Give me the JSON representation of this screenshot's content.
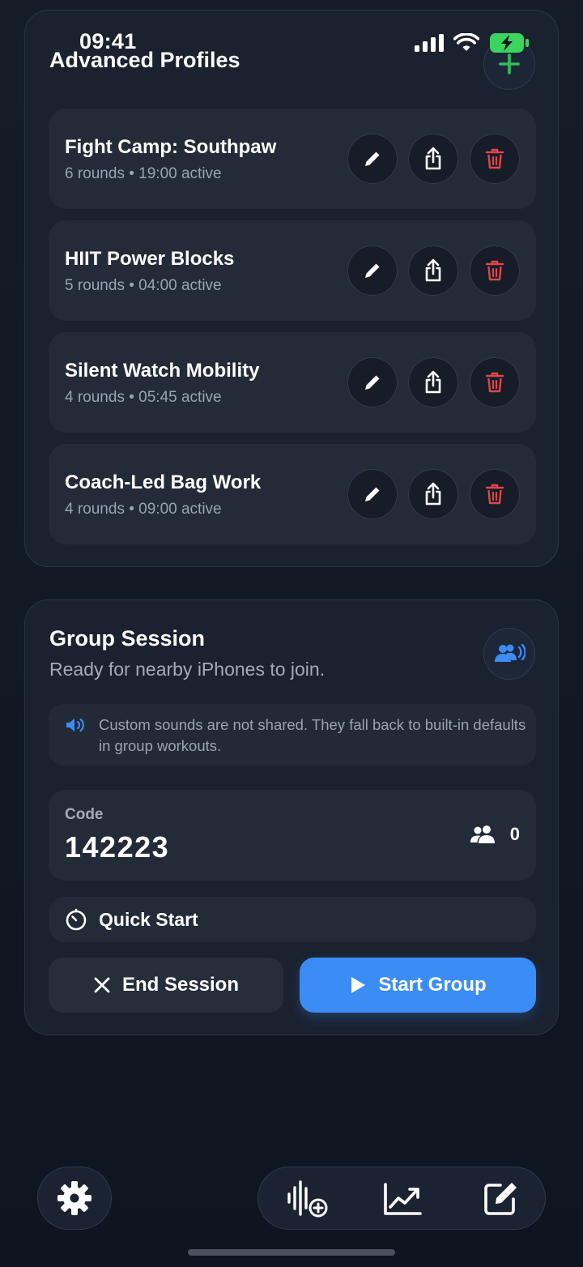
{
  "status_bar": {
    "time": "09:41"
  },
  "profiles_card": {
    "title": "Advanced Profiles",
    "profiles": [
      {
        "name": "Fight Camp: Southpaw",
        "meta": "6 rounds • 19:00 active"
      },
      {
        "name": "HIIT Power Blocks",
        "meta": "5 rounds • 04:00 active"
      },
      {
        "name": "Silent Watch Mobility",
        "meta": "4 rounds • 05:45 active"
      },
      {
        "name": "Coach-Led Bag Work",
        "meta": "4 rounds • 09:00 active"
      }
    ]
  },
  "group_session": {
    "title": "Group Session",
    "subtitle": "Ready for nearby iPhones to join.",
    "info": "Custom sounds are not shared. They fall back to built-in defaults in group workouts.",
    "code_label": "Code",
    "code": "142223",
    "participant_count": "0",
    "quick_start_label": "Quick Start",
    "end_label": "End Session",
    "start_label": "Start Group"
  },
  "colors": {
    "accent_blue": "#3b8cf4",
    "delete_red": "#e04646",
    "add_green": "#2fbf5a",
    "background": "#131b27"
  },
  "icons": {
    "status": [
      "cellular-icon",
      "wifi-icon",
      "battery-charging-icon"
    ],
    "profile_actions": [
      "pencil-icon",
      "share-icon",
      "trash-icon"
    ],
    "tab_bar": [
      "settings-icon",
      "waveform-add-icon",
      "chart-icon",
      "compose-icon"
    ]
  }
}
